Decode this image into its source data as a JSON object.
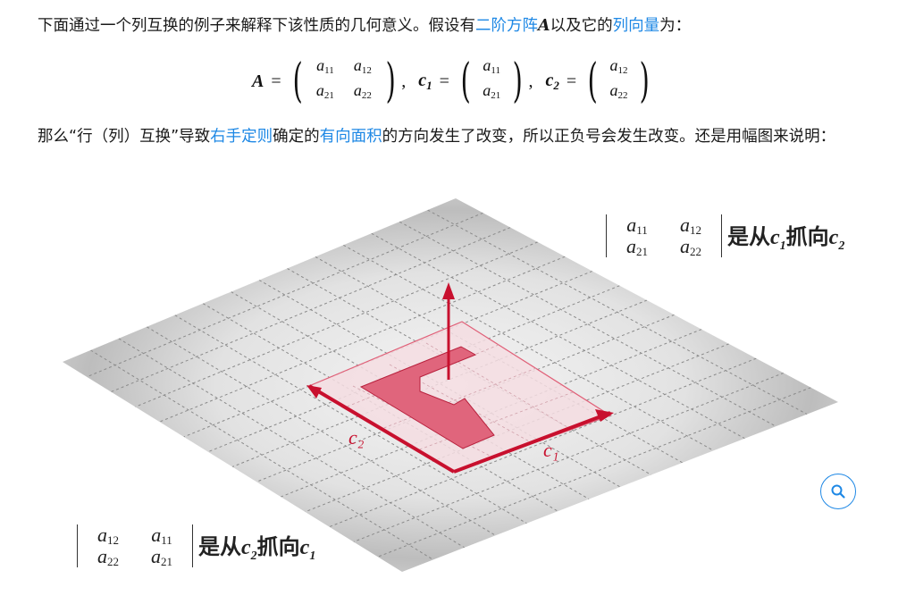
{
  "intro": {
    "text_before": "下面通过一个列互换的例子来解释下该性质的几何意义。假设有",
    "link_matrix": "二阶方阵",
    "symbol_A": "A",
    "text_mid": "以及它的",
    "link_column": "列向量",
    "text_after": "为："
  },
  "math": {
    "A": "A",
    "c1": "c",
    "c1_sub": "1",
    "c2": "c",
    "c2_sub": "2",
    "equals": "=",
    "comma": ",",
    "a11": "a",
    "a11_sub": "11",
    "a12": "a",
    "a12_sub": "12",
    "a21": "a",
    "a21_sub": "21",
    "a22": "a",
    "a22_sub": "22"
  },
  "para2": {
    "text_before": "那么“行（列）互换”导致",
    "link_right_hand": "右手定则",
    "text_mid": "确定的",
    "link_area": "有向面积",
    "text_after": "的方向发生了改变，所以正负号会发生改变。还是用幅图来说明："
  },
  "figure": {
    "vector_label_c2": "c₂",
    "vector_label_c1": "c₁",
    "top_caption": {
      "cells": [
        "11",
        "12",
        "21",
        "22"
      ],
      "text_prefix": "是从",
      "from": "c",
      "from_sub": "1",
      "mid": "抓向",
      "to": "c",
      "to_sub": "2"
    },
    "bottom_caption": {
      "cells": [
        "12",
        "11",
        "22",
        "21"
      ],
      "text_prefix": "是从",
      "from": "c",
      "from_sub": "2",
      "mid": "抓向",
      "to": "c",
      "to_sub": "1"
    },
    "colors": {
      "accent_red": "#c8102e",
      "fill_pink": "#f2c6cf",
      "letter_fill": "#e06078",
      "grid_gray": "#a0a0a0",
      "link_blue": "#1e88e5"
    }
  },
  "zoom_icon": "magnifier-icon"
}
